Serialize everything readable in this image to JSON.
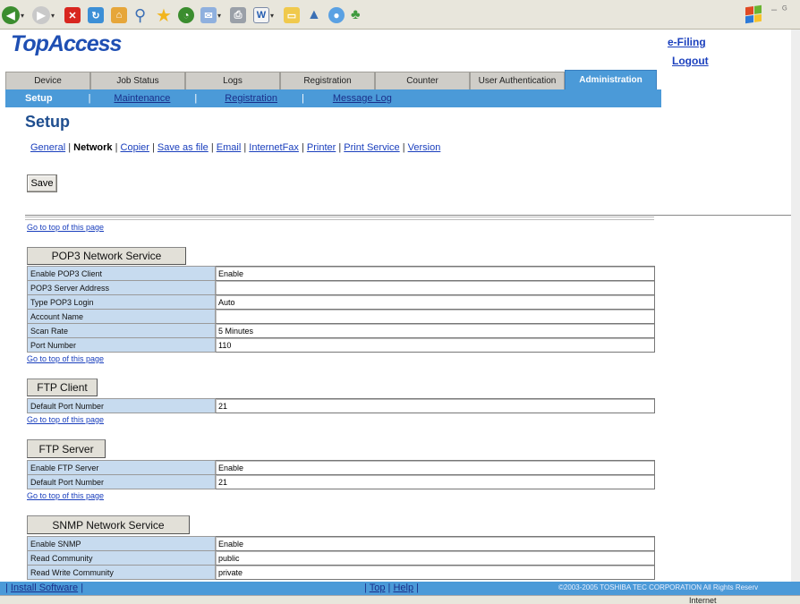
{
  "browser": {
    "toolbar_icons": [
      "back-icon",
      "forward-icon",
      "stop-icon",
      "refresh-icon",
      "home-icon",
      "search-icon",
      "favorites-icon",
      "history-icon",
      "mail-icon",
      "print-icon",
      "edit-icon",
      "folder-icon",
      "research-icon",
      "messenger-icon",
      "users-icon"
    ]
  },
  "header": {
    "logo": "TopAccess",
    "efiling": "e-Filing",
    "logout": "Logout"
  },
  "tabs": [
    "Device",
    "Job Status",
    "Logs",
    "Registration",
    "Counter",
    "User Authentication",
    "Administration"
  ],
  "subnav": {
    "current": "Setup",
    "links": [
      "Maintenance",
      "Registration",
      "Message Log"
    ],
    "sep": "|"
  },
  "page_title": "Setup",
  "sublinks": {
    "items": [
      "General",
      "Network",
      "Copier",
      "Save as file",
      "Email",
      "InternetFax",
      "Printer",
      "Print Service",
      "Version"
    ],
    "sep": "|"
  },
  "save_label": "Save",
  "goto_top": "Go to top of this page",
  "sections": {
    "pop3": {
      "title": "POP3 Network Service",
      "rows": [
        {
          "k": "Enable POP3 Client",
          "v": "Enable"
        },
        {
          "k": "POP3 Server Address",
          "v": ""
        },
        {
          "k": "Type POP3 Login",
          "v": "Auto"
        },
        {
          "k": "Account Name",
          "v": ""
        },
        {
          "k": "Scan Rate",
          "v": "5 Minutes"
        },
        {
          "k": "Port Number",
          "v": "110"
        }
      ]
    },
    "ftpclient": {
      "title": "FTP Client",
      "rows": [
        {
          "k": "Default Port Number",
          "v": "21"
        }
      ]
    },
    "ftpserver": {
      "title": "FTP Server",
      "rows": [
        {
          "k": "Enable FTP Server",
          "v": "Enable"
        },
        {
          "k": "Default Port Number",
          "v": "21"
        }
      ]
    },
    "snmp": {
      "title": "SNMP Network Service",
      "rows": [
        {
          "k": "Enable SNMP",
          "v": "Enable"
        },
        {
          "k": "Read Community",
          "v": "public"
        },
        {
          "k": "Read Write Community",
          "v": "private"
        }
      ]
    }
  },
  "footer": {
    "install": "Install Software",
    "sep": "|",
    "top": "Top",
    "help": "Help",
    "copyright": "©2003-2005 TOSHIBA TEC CORPORATION All Rights Reserv"
  },
  "status": {
    "zone": "Internet"
  }
}
